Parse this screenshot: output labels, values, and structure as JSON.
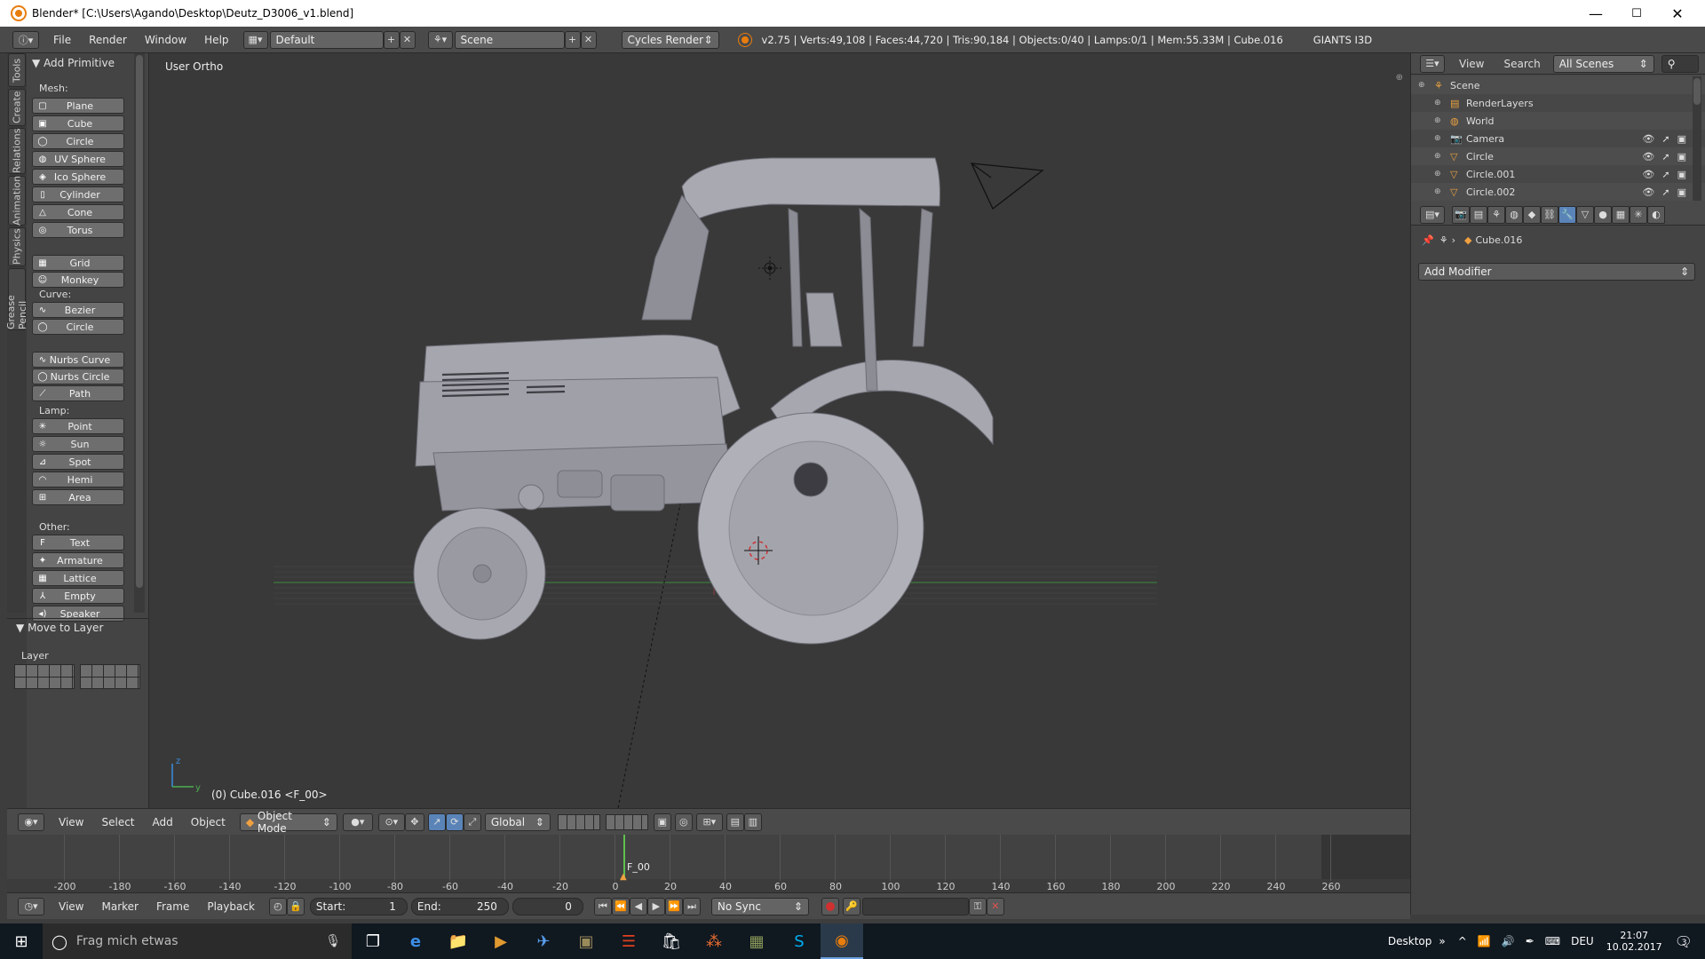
{
  "window": {
    "title": "Blender* [C:\\Users\\Agando\\Desktop\\Deutz_D3006_v1.blend]",
    "minimize": "—",
    "maximize": "☐",
    "close": "✕"
  },
  "infobar": {
    "menus": [
      "File",
      "Render",
      "Window",
      "Help"
    ],
    "layout": "Default",
    "scene": "Scene",
    "engine": "Cycles Render",
    "stats": "v2.75 | Verts:49,108 | Faces:44,720 | Tris:90,184 | Objects:0/40 | Lamps:0/1 | Mem:55.33M | Cube.016",
    "addon": "GIANTS I3D"
  },
  "tabs": [
    "Tools",
    "Create",
    "Relations",
    "Animation",
    "Physics",
    "Grease Pencil"
  ],
  "toolshelf": {
    "panel_title": "Add Primitive",
    "mesh_label": "Mesh:",
    "mesh": [
      {
        "label": "Plane",
        "icon": "plane-icon",
        "glyph": "▢"
      },
      {
        "label": "Cube",
        "icon": "cube-icon",
        "glyph": "▣"
      },
      {
        "label": "Circle",
        "icon": "circle-icon",
        "glyph": "◯"
      },
      {
        "label": "UV Sphere",
        "icon": "uv-sphere-icon",
        "glyph": "◍"
      },
      {
        "label": "Ico Sphere",
        "icon": "ico-sphere-icon",
        "glyph": "◈"
      },
      {
        "label": "Cylinder",
        "icon": "cylinder-icon",
        "glyph": "▯"
      },
      {
        "label": "Cone",
        "icon": "cone-icon",
        "glyph": "△"
      },
      {
        "label": "Torus",
        "icon": "torus-icon",
        "glyph": "◎"
      }
    ],
    "mesh2": [
      {
        "label": "Grid",
        "icon": "grid-icon",
        "glyph": "▦"
      },
      {
        "label": "Monkey",
        "icon": "monkey-icon",
        "glyph": "☺"
      }
    ],
    "curve_label": "Curve:",
    "curve": [
      {
        "label": "Bezier",
        "icon": "bezier-icon",
        "glyph": "∿"
      },
      {
        "label": "Circle",
        "icon": "curve-circle-icon",
        "glyph": "◯"
      }
    ],
    "curve2": [
      {
        "label": "Nurbs Curve",
        "icon": "nurbs-curve-icon",
        "glyph": "∿"
      },
      {
        "label": "Nurbs Circle",
        "icon": "nurbs-circle-icon",
        "glyph": "◯"
      },
      {
        "label": "Path",
        "icon": "path-icon",
        "glyph": "⟋"
      }
    ],
    "lamp_label": "Lamp:",
    "lamp": [
      {
        "label": "Point",
        "icon": "point-lamp-icon",
        "glyph": "✳"
      },
      {
        "label": "Sun",
        "icon": "sun-icon",
        "glyph": "☼"
      },
      {
        "label": "Spot",
        "icon": "spot-icon",
        "glyph": "⊿"
      },
      {
        "label": "Hemi",
        "icon": "hemi-icon",
        "glyph": "◠"
      },
      {
        "label": "Area",
        "icon": "area-lamp-icon",
        "glyph": "⊞"
      }
    ],
    "other_label": "Other:",
    "other": [
      {
        "label": "Text",
        "icon": "text-icon",
        "glyph": "F"
      },
      {
        "label": "Armature",
        "icon": "armature-icon",
        "glyph": "✦"
      },
      {
        "label": "Lattice",
        "icon": "lattice-icon",
        "glyph": "▦"
      },
      {
        "label": "Empty",
        "icon": "empty-icon",
        "glyph": "⅄"
      },
      {
        "label": "Speaker",
        "icon": "speaker-icon",
        "glyph": "◂)"
      }
    ],
    "move_to_layer": "Move to Layer",
    "layer_label": "Layer"
  },
  "viewport": {
    "view_label": "User Ortho",
    "object_label": "(0) Cube.016 <F_00>"
  },
  "vp_header": {
    "menus": [
      "View",
      "Select",
      "Add",
      "Object"
    ],
    "mode": "Object Mode",
    "orientation": "Global"
  },
  "timeline": {
    "ticks": [
      "-200",
      "-180",
      "-160",
      "-140",
      "-120",
      "-100",
      "-80",
      "-60",
      "-40",
      "-20",
      "0",
      "20",
      "40",
      "60",
      "80",
      "100",
      "120",
      "140",
      "160",
      "180",
      "200",
      "220",
      "240",
      "260"
    ],
    "marker": "F_00"
  },
  "tl_header": {
    "menus": [
      "View",
      "Marker",
      "Frame",
      "Playback"
    ],
    "start": "Start:",
    "start_val": "1",
    "end": "End:",
    "end_val": "250",
    "current": "0",
    "sync": "No Sync"
  },
  "outliner": {
    "menus": [
      "View",
      "Search"
    ],
    "filter": "All Scenes",
    "rows": [
      {
        "label": "Scene",
        "icon": "scene-icon",
        "indent": 0
      },
      {
        "label": "RenderLayers",
        "icon": "renderlayers-icon",
        "indent": 1
      },
      {
        "label": "World",
        "icon": "world-icon",
        "indent": 1
      },
      {
        "label": "Camera",
        "icon": "camera-icon",
        "indent": 1
      },
      {
        "label": "Circle",
        "icon": "mesh-icon",
        "indent": 1
      },
      {
        "label": "Circle.001",
        "icon": "mesh-icon",
        "indent": 1
      },
      {
        "label": "Circle.002",
        "icon": "mesh-icon",
        "indent": 1
      }
    ]
  },
  "properties": {
    "object": "Cube.016",
    "add_modifier": "Add Modifier"
  },
  "taskbar": {
    "search": "Frag mich etwas",
    "desktop": "Desktop",
    "lang": "DEU",
    "time": "21:07",
    "date": "10.02.2017",
    "notifications": "3"
  }
}
